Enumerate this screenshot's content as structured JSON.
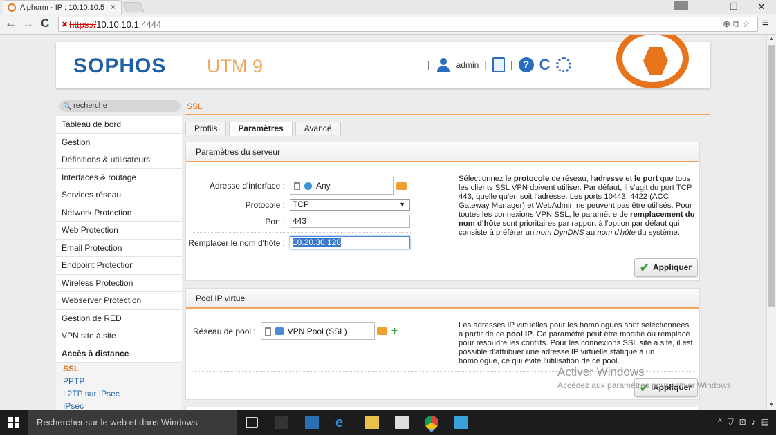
{
  "browser": {
    "tab_title": "Alphorm - IP : 10.10.10.5",
    "tab_close": "×",
    "url_scheme": "https://",
    "url_host": "10.10.10.1",
    "url_port": ":4444",
    "nav_back": "←",
    "nav_forward": "→",
    "nav_reload": "C",
    "menu": "≡",
    "win_minimize": "–",
    "win_maximize": "❐",
    "win_close": "✕"
  },
  "header": {
    "logo": "SOPHOS",
    "product": "UTM 9",
    "separator": "|",
    "username": "admin",
    "help_glyph": "?",
    "refresh_glyph": "C"
  },
  "search": {
    "placeholder": "recherche"
  },
  "breadcrumb": "SSL",
  "sidebar": {
    "items": [
      "Tableau de bord",
      "Gestion",
      "Définitions & utilisateurs",
      "Interfaces & routage",
      "Services réseau",
      "Network Protection",
      "Web Protection",
      "Email Protection",
      "Endpoint Protection",
      "Wireless Protection",
      "Webserver Protection",
      "Gestion de RED",
      "VPN site à site"
    ],
    "open_item": "Accès à distance",
    "subitems": [
      "SSL",
      "PPTP",
      "L2TP sur IPsec",
      "IPsec"
    ]
  },
  "tabs": [
    {
      "label": "Profils"
    },
    {
      "label": "Paramètres"
    },
    {
      "label": "Avancé"
    }
  ],
  "server_panel": {
    "title": "Paramètres du serveur",
    "interface_label": "Adresse d'interface :",
    "interface_value": "Any",
    "protocol_label": "Protocole :",
    "protocol_value": "TCP",
    "port_label": "Port :",
    "port_value": "443",
    "hostname_label": "Remplacer le nom d'hôte :",
    "hostname_value": "10.20.30.128",
    "help_parts": [
      "Sélectionnez le ",
      "protocole",
      " de réseau, l'",
      "adresse",
      " et ",
      "le port",
      " que tous les clients SSL VPN doivent utiliser. Par défaut, il s'agit du port TCP 443, quelle qu'en soit l'adresse. Les ports 10443, 4422 (ACC Gateway Manager) et WebAdmin ne peuvent pas être utilisés. Pour toutes les connexions VPN SSL, le paramètre de ",
      "remplacement du nom d'hôte",
      " sont prioritaires par rapport à l'option par défaut qui consiste à préférer un ",
      "nom DynDNS",
      " au ",
      "nom d'hôte",
      " du système."
    ],
    "apply": "Appliquer"
  },
  "pool_panel": {
    "title": "Pool IP virtuel",
    "network_label": "Réseau de pool :",
    "network_value": "VPN Pool (SSL)",
    "help_parts": [
      "Les adresses IP virtuelles pour les homologues sont sélectionnées à partir de ce ",
      "pool IP",
      ". Ce paramètre peut être modifié ou remplacé pour résoudre les conflits. Pour les connexions SSL site à site, il est possible d'attribuer une adresse IP virtuelle statique à un homologue, ce qui évite l'utilisation de ce pool."
    ],
    "apply": "Appliquer",
    "add_glyph": "+"
  },
  "watermark": {
    "title": "Activer Windows",
    "subtitle": "Accédez aux paramètres pour activer Windows."
  },
  "taskbar": {
    "search_placeholder": "Rechercher sur le web et dans Windows"
  },
  "colors": {
    "accent_orange": "#e8731d",
    "sophos_blue": "#1f5fa8",
    "apply_green": "#3aa13a"
  }
}
